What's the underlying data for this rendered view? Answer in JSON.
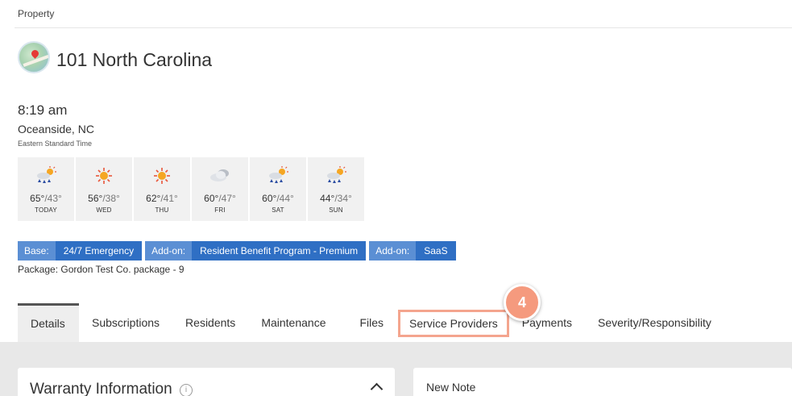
{
  "breadcrumb": "Property",
  "property": {
    "title": "101 North Carolina"
  },
  "clock": {
    "time": "8:19 am",
    "location": "Oceanside, NC",
    "timezone": "Eastern Standard Time"
  },
  "forecast": [
    {
      "icon": "rain-sun-icon",
      "high": "65°",
      "low": "/43°",
      "day": "TODAY"
    },
    {
      "icon": "sun-icon",
      "high": "56°",
      "low": "/38°",
      "day": "WED"
    },
    {
      "icon": "sun-icon",
      "high": "62°",
      "low": "/41°",
      "day": "THU"
    },
    {
      "icon": "cloud-icon",
      "high": "60°",
      "low": "/47°",
      "day": "FRI"
    },
    {
      "icon": "rain-sun-icon",
      "high": "60°",
      "low": "/44°",
      "day": "SAT"
    },
    {
      "icon": "rain-sun-icon",
      "high": "44°",
      "low": "/34°",
      "day": "SUN"
    }
  ],
  "badges": [
    {
      "key": "Base:",
      "value": "24/7 Emergency"
    },
    {
      "key": "Add-on:",
      "value": "Resident Benefit Program - Premium"
    },
    {
      "key": "Add-on:",
      "value": "SaaS"
    }
  ],
  "package": "Package: Gordon Test Co. package - 9",
  "tabs": [
    "Details",
    "Subscriptions",
    "Residents",
    "Maintenance",
    "Files",
    "Service Providers",
    "Payments",
    "Severity/Responsibility"
  ],
  "step_marker": "4",
  "cards": {
    "warranty_title": "Warranty Information",
    "note_title": "New Note"
  },
  "colors": {
    "badge_key": "#5b8fd4",
    "badge_value": "#2f6fc4",
    "highlight": "#f4a58e",
    "step_bubble": "#f59a7e"
  }
}
